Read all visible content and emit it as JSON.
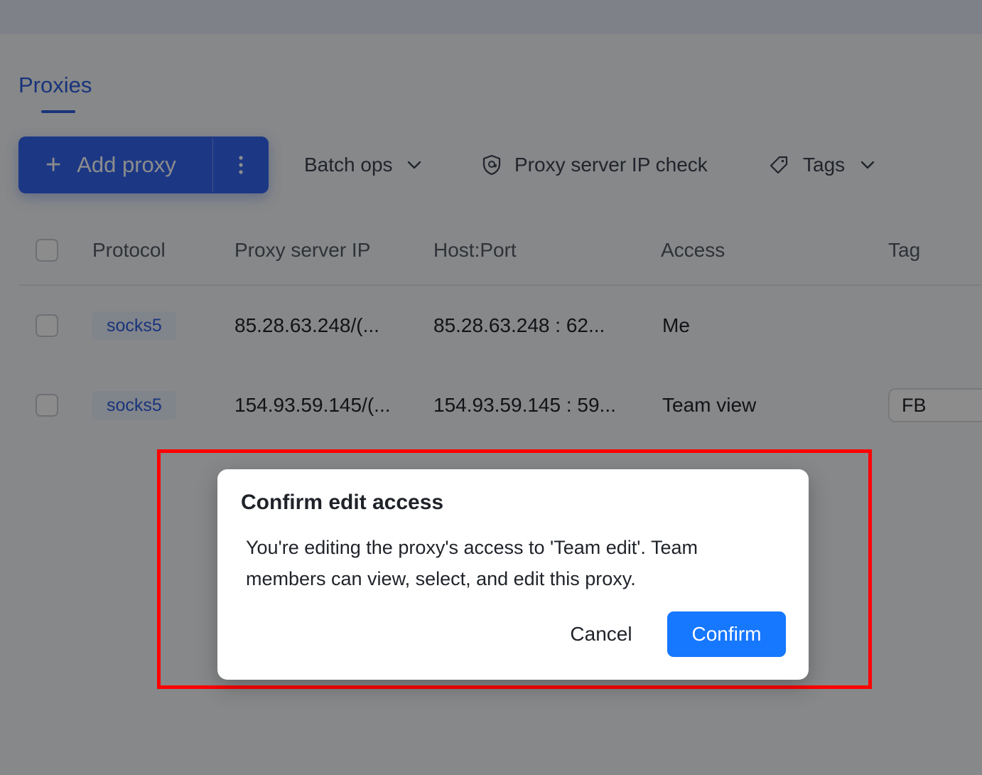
{
  "tabs": {
    "active_label": "Proxies"
  },
  "toolbar": {
    "add_label": "Add proxy",
    "batch_label": "Batch ops",
    "ip_check_label": "Proxy server IP check",
    "tags_label": "Tags"
  },
  "table": {
    "headers": {
      "protocol": "Protocol",
      "ip": "Proxy server IP",
      "hostport": "Host:Port",
      "access": "Access",
      "tag": "Tag"
    },
    "rows": [
      {
        "protocol": "socks5",
        "ip": "85.28.63.248/(...",
        "hostport": "85.28.63.248 : 62...",
        "access": "Me",
        "tag": ""
      },
      {
        "protocol": "socks5",
        "ip": "154.93.59.145/(...",
        "hostport": "154.93.59.145 : 59...",
        "access": "Team view",
        "tag": "FB"
      }
    ]
  },
  "modal": {
    "title": "Confirm edit access",
    "body": "You're editing the proxy's access to 'Team edit'. Team members can view, select, and edit this proxy.",
    "cancel_label": "Cancel",
    "confirm_label": "Confirm"
  },
  "colors": {
    "primary": "#3466f2",
    "confirm": "#1677ff",
    "highlight": "#ff0000"
  }
}
